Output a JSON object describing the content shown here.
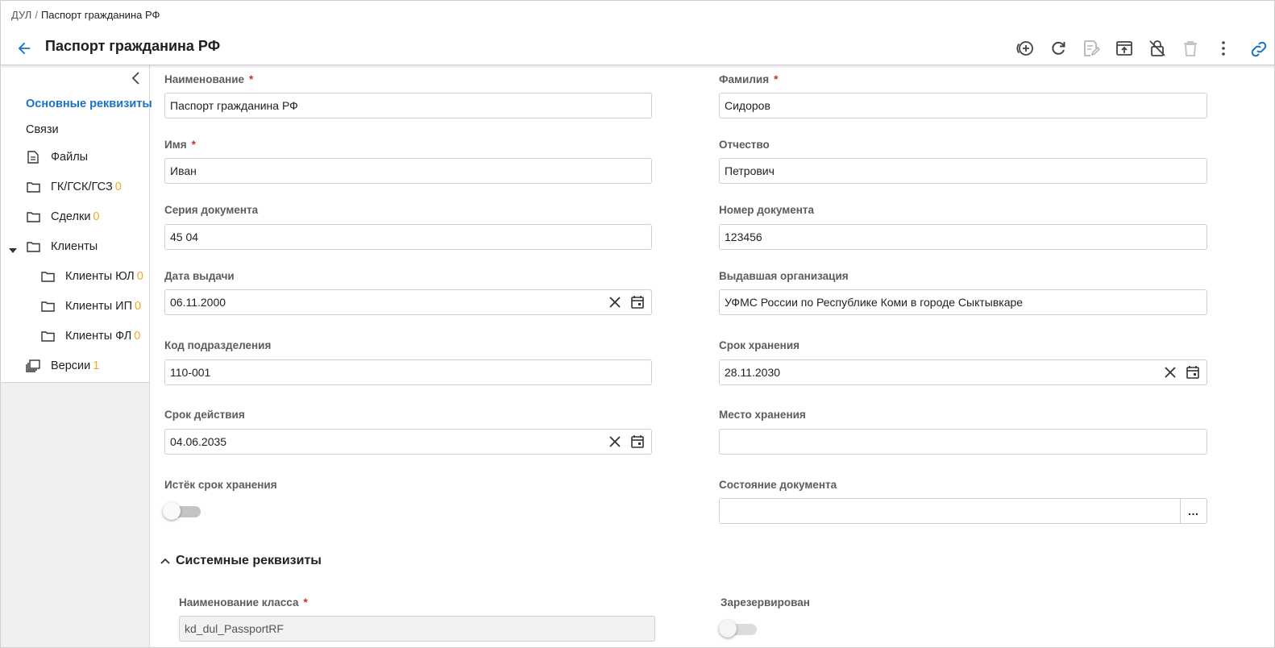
{
  "breadcrumb": {
    "parent": "ДУЛ",
    "separator": "/",
    "current": "Паспорт гражданина РФ"
  },
  "header": {
    "title": "Паспорт гражданина РФ"
  },
  "toolbar": {
    "icons": [
      "add-circle-icon",
      "refresh-icon",
      "save-edit-icon",
      "open-in-new-icon",
      "unlock-icon",
      "delete-icon",
      "more-vert-icon",
      "link-icon"
    ]
  },
  "sidebar": {
    "items": [
      {
        "label": "Основные реквизиты",
        "active": true
      },
      {
        "label": "Связи"
      },
      {
        "label": "Файлы",
        "icon": "file-icon"
      },
      {
        "label": "ГК/ГСК/ГСЗ",
        "count": "0",
        "icon": "folder-icon"
      },
      {
        "label": "Сделки",
        "count": "0",
        "icon": "folder-icon"
      },
      {
        "label": "Клиенты",
        "icon": "folder-icon",
        "expanded": true
      },
      {
        "label": "Клиенты ЮЛ",
        "count": "0",
        "icon": "folder-icon"
      },
      {
        "label": "Клиенты ИП",
        "count": "0",
        "icon": "folder-icon"
      },
      {
        "label": "Клиенты ФЛ",
        "count": "0",
        "icon": "folder-icon"
      },
      {
        "label": "Версии",
        "count": "1",
        "icon": "versions-icon"
      }
    ]
  },
  "form": {
    "name": {
      "label": "Наименование",
      "required": "*",
      "value": "Паспорт гражданина РФ"
    },
    "surname": {
      "label": "Фамилия",
      "required": "*",
      "value": "Сидоров"
    },
    "first_name": {
      "label": "Имя",
      "required": "*",
      "value": "Иван"
    },
    "patronymic": {
      "label": "Отчество",
      "value": "Петрович"
    },
    "doc_series": {
      "label": "Серия документа",
      "value": "45 04"
    },
    "doc_number": {
      "label": "Номер документа",
      "value": "123456"
    },
    "issue_date": {
      "label": "Дата выдачи",
      "value": "06.11.2000"
    },
    "issuer": {
      "label": "Выдавшая организация",
      "value": "УФМС России по Республике Коми в городе Сыктывкаре"
    },
    "division_code": {
      "label": "Код подразделения",
      "value": "110-001"
    },
    "storage_term": {
      "label": "Срок хранения",
      "value": "28.11.2030"
    },
    "validity": {
      "label": "Срок действия",
      "value": "04.06.2035"
    },
    "storage_place": {
      "label": "Место хранения",
      "value": ""
    },
    "storage_expired": {
      "label": "Истёк срок хранения",
      "checked": false
    },
    "doc_state": {
      "label": "Состояние документа",
      "value": "",
      "button": "…"
    }
  },
  "system": {
    "title": "Системные реквизиты",
    "class_name": {
      "label": "Наименование класса",
      "required": "*",
      "value": "kd_dul_PassportRF"
    },
    "reserved": {
      "label": "Зарезервирован",
      "checked": false
    }
  },
  "colors": {
    "accent": "#1a73c8",
    "required": "#d62b1f",
    "count": "#f5a623"
  }
}
